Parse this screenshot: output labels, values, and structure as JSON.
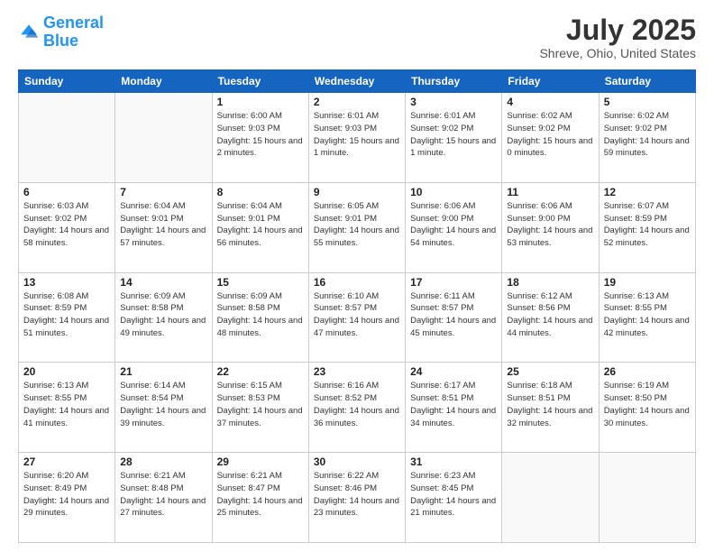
{
  "header": {
    "logo_line1": "General",
    "logo_line2": "Blue",
    "title": "July 2025",
    "subtitle": "Shreve, Ohio, United States"
  },
  "weekdays": [
    "Sunday",
    "Monday",
    "Tuesday",
    "Wednesday",
    "Thursday",
    "Friday",
    "Saturday"
  ],
  "weeks": [
    [
      {
        "day": "",
        "sunrise": "",
        "sunset": "",
        "daylight": ""
      },
      {
        "day": "",
        "sunrise": "",
        "sunset": "",
        "daylight": ""
      },
      {
        "day": "1",
        "sunrise": "Sunrise: 6:00 AM",
        "sunset": "Sunset: 9:03 PM",
        "daylight": "Daylight: 15 hours and 2 minutes."
      },
      {
        "day": "2",
        "sunrise": "Sunrise: 6:01 AM",
        "sunset": "Sunset: 9:03 PM",
        "daylight": "Daylight: 15 hours and 1 minute."
      },
      {
        "day": "3",
        "sunrise": "Sunrise: 6:01 AM",
        "sunset": "Sunset: 9:02 PM",
        "daylight": "Daylight: 15 hours and 1 minute."
      },
      {
        "day": "4",
        "sunrise": "Sunrise: 6:02 AM",
        "sunset": "Sunset: 9:02 PM",
        "daylight": "Daylight: 15 hours and 0 minutes."
      },
      {
        "day": "5",
        "sunrise": "Sunrise: 6:02 AM",
        "sunset": "Sunset: 9:02 PM",
        "daylight": "Daylight: 14 hours and 59 minutes."
      }
    ],
    [
      {
        "day": "6",
        "sunrise": "Sunrise: 6:03 AM",
        "sunset": "Sunset: 9:02 PM",
        "daylight": "Daylight: 14 hours and 58 minutes."
      },
      {
        "day": "7",
        "sunrise": "Sunrise: 6:04 AM",
        "sunset": "Sunset: 9:01 PM",
        "daylight": "Daylight: 14 hours and 57 minutes."
      },
      {
        "day": "8",
        "sunrise": "Sunrise: 6:04 AM",
        "sunset": "Sunset: 9:01 PM",
        "daylight": "Daylight: 14 hours and 56 minutes."
      },
      {
        "day": "9",
        "sunrise": "Sunrise: 6:05 AM",
        "sunset": "Sunset: 9:01 PM",
        "daylight": "Daylight: 14 hours and 55 minutes."
      },
      {
        "day": "10",
        "sunrise": "Sunrise: 6:06 AM",
        "sunset": "Sunset: 9:00 PM",
        "daylight": "Daylight: 14 hours and 54 minutes."
      },
      {
        "day": "11",
        "sunrise": "Sunrise: 6:06 AM",
        "sunset": "Sunset: 9:00 PM",
        "daylight": "Daylight: 14 hours and 53 minutes."
      },
      {
        "day": "12",
        "sunrise": "Sunrise: 6:07 AM",
        "sunset": "Sunset: 8:59 PM",
        "daylight": "Daylight: 14 hours and 52 minutes."
      }
    ],
    [
      {
        "day": "13",
        "sunrise": "Sunrise: 6:08 AM",
        "sunset": "Sunset: 8:59 PM",
        "daylight": "Daylight: 14 hours and 51 minutes."
      },
      {
        "day": "14",
        "sunrise": "Sunrise: 6:09 AM",
        "sunset": "Sunset: 8:58 PM",
        "daylight": "Daylight: 14 hours and 49 minutes."
      },
      {
        "day": "15",
        "sunrise": "Sunrise: 6:09 AM",
        "sunset": "Sunset: 8:58 PM",
        "daylight": "Daylight: 14 hours and 48 minutes."
      },
      {
        "day": "16",
        "sunrise": "Sunrise: 6:10 AM",
        "sunset": "Sunset: 8:57 PM",
        "daylight": "Daylight: 14 hours and 47 minutes."
      },
      {
        "day": "17",
        "sunrise": "Sunrise: 6:11 AM",
        "sunset": "Sunset: 8:57 PM",
        "daylight": "Daylight: 14 hours and 45 minutes."
      },
      {
        "day": "18",
        "sunrise": "Sunrise: 6:12 AM",
        "sunset": "Sunset: 8:56 PM",
        "daylight": "Daylight: 14 hours and 44 minutes."
      },
      {
        "day": "19",
        "sunrise": "Sunrise: 6:13 AM",
        "sunset": "Sunset: 8:55 PM",
        "daylight": "Daylight: 14 hours and 42 minutes."
      }
    ],
    [
      {
        "day": "20",
        "sunrise": "Sunrise: 6:13 AM",
        "sunset": "Sunset: 8:55 PM",
        "daylight": "Daylight: 14 hours and 41 minutes."
      },
      {
        "day": "21",
        "sunrise": "Sunrise: 6:14 AM",
        "sunset": "Sunset: 8:54 PM",
        "daylight": "Daylight: 14 hours and 39 minutes."
      },
      {
        "day": "22",
        "sunrise": "Sunrise: 6:15 AM",
        "sunset": "Sunset: 8:53 PM",
        "daylight": "Daylight: 14 hours and 37 minutes."
      },
      {
        "day": "23",
        "sunrise": "Sunrise: 6:16 AM",
        "sunset": "Sunset: 8:52 PM",
        "daylight": "Daylight: 14 hours and 36 minutes."
      },
      {
        "day": "24",
        "sunrise": "Sunrise: 6:17 AM",
        "sunset": "Sunset: 8:51 PM",
        "daylight": "Daylight: 14 hours and 34 minutes."
      },
      {
        "day": "25",
        "sunrise": "Sunrise: 6:18 AM",
        "sunset": "Sunset: 8:51 PM",
        "daylight": "Daylight: 14 hours and 32 minutes."
      },
      {
        "day": "26",
        "sunrise": "Sunrise: 6:19 AM",
        "sunset": "Sunset: 8:50 PM",
        "daylight": "Daylight: 14 hours and 30 minutes."
      }
    ],
    [
      {
        "day": "27",
        "sunrise": "Sunrise: 6:20 AM",
        "sunset": "Sunset: 8:49 PM",
        "daylight": "Daylight: 14 hours and 29 minutes."
      },
      {
        "day": "28",
        "sunrise": "Sunrise: 6:21 AM",
        "sunset": "Sunset: 8:48 PM",
        "daylight": "Daylight: 14 hours and 27 minutes."
      },
      {
        "day": "29",
        "sunrise": "Sunrise: 6:21 AM",
        "sunset": "Sunset: 8:47 PM",
        "daylight": "Daylight: 14 hours and 25 minutes."
      },
      {
        "day": "30",
        "sunrise": "Sunrise: 6:22 AM",
        "sunset": "Sunset: 8:46 PM",
        "daylight": "Daylight: 14 hours and 23 minutes."
      },
      {
        "day": "31",
        "sunrise": "Sunrise: 6:23 AM",
        "sunset": "Sunset: 8:45 PM",
        "daylight": "Daylight: 14 hours and 21 minutes."
      },
      {
        "day": "",
        "sunrise": "",
        "sunset": "",
        "daylight": ""
      },
      {
        "day": "",
        "sunrise": "",
        "sunset": "",
        "daylight": ""
      }
    ]
  ]
}
